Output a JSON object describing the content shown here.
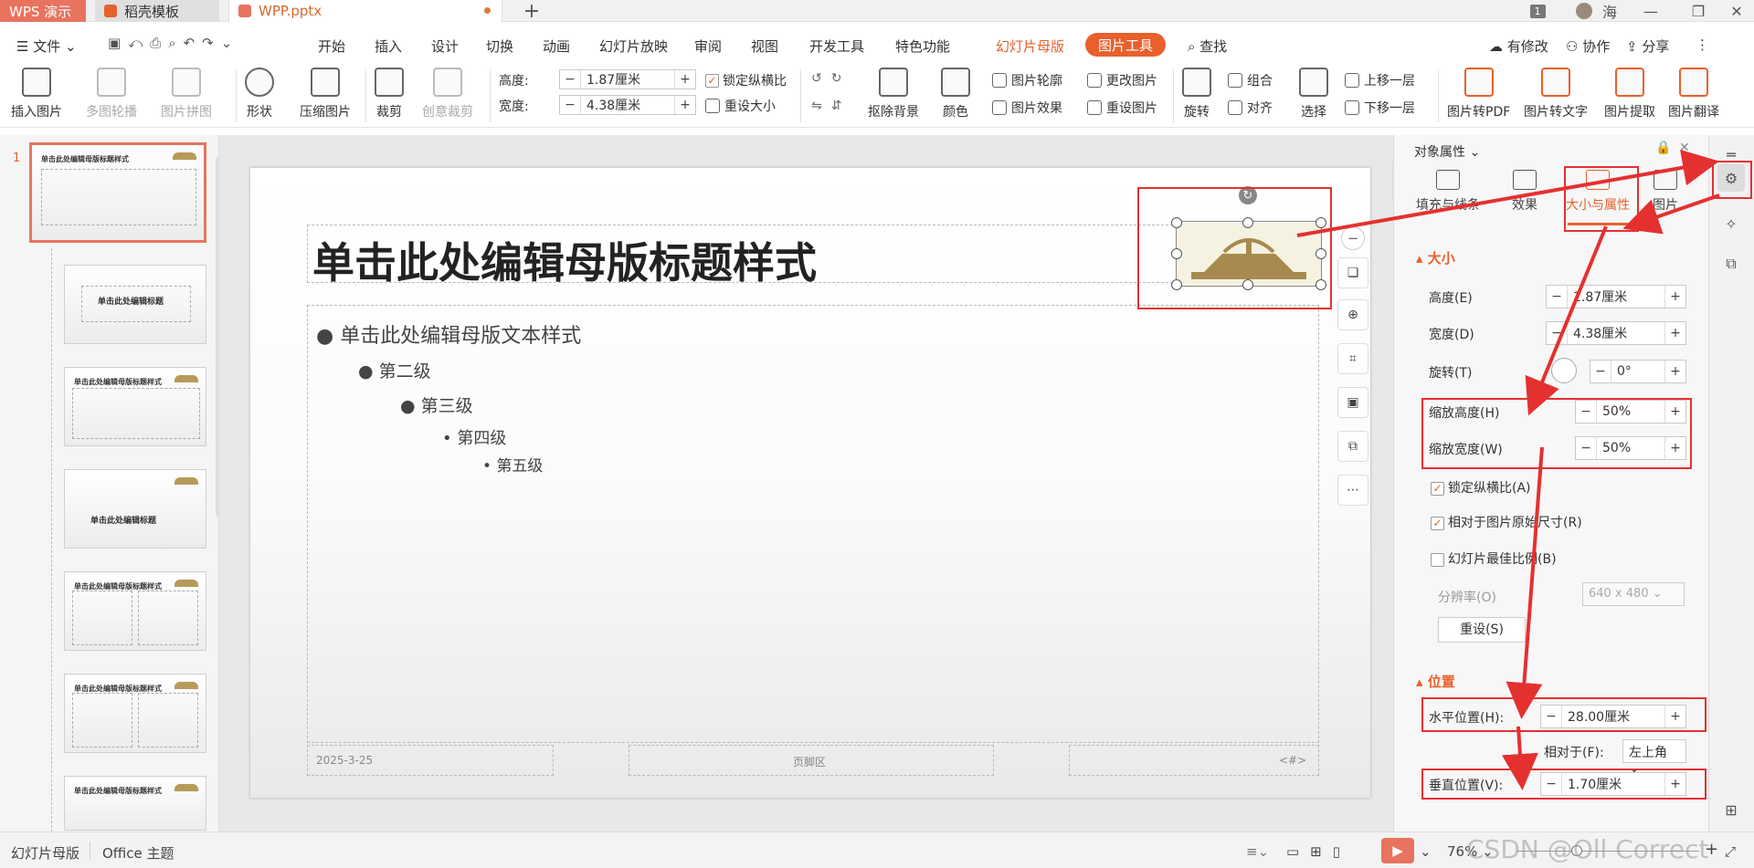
{
  "titlebar": {
    "tabs": [
      "WPS 演示",
      "稻壳模板",
      "WPP.pptx"
    ],
    "user": "海",
    "badge": "1",
    "new_tab": "+"
  },
  "menubar": {
    "file": "文件",
    "items": [
      "开始",
      "插入",
      "设计",
      "切换",
      "动画",
      "幻灯片放映",
      "审阅",
      "视图",
      "开发工具",
      "特色功能"
    ],
    "master": "幻灯片母版",
    "pic_tool": "图片工具",
    "search": "查找",
    "right": [
      "有修改",
      "协作",
      "分享"
    ]
  },
  "ribbon": {
    "insert_pic": "插入图片",
    "multi_carousel": "多图轮播",
    "pic_collage": "图片拼图",
    "shape": "形状",
    "compress": "压缩图片",
    "crop": "裁剪",
    "creative_crop": "创意裁剪",
    "height_label": "高度:",
    "height_value": "1.87厘米",
    "width_label": "宽度:",
    "width_value": "4.38厘米",
    "lock_ratio": "锁定纵横比",
    "reset_size": "重设大小",
    "remove_bg": "抠除背景",
    "color": "颜色",
    "pic_outline": "图片轮廓",
    "pic_effect": "图片效果",
    "change_pic": "更改图片",
    "reset_pic": "重设图片",
    "rotate": "旋转",
    "group": "组合",
    "align": "对齐",
    "select": "选择",
    "bring_forward": "上移一层",
    "send_backward": "下移一层",
    "to_pdf": "图片转PDF",
    "to_text": "图片转文字",
    "extract": "图片提取",
    "translate": "图片翻译"
  },
  "thumbs": {
    "number": "1",
    "title_text": "单击此处编辑母版标题样式",
    "title_short": "单击此处编辑标题"
  },
  "slide": {
    "title": "单击此处编辑母版标题样式",
    "levels": [
      "单击此处编辑母版文本样式",
      "第二级",
      "第三级",
      "第四级",
      "第五级"
    ],
    "date": "2025-3-25",
    "footer": "页脚区",
    "page": "<#>"
  },
  "panel": {
    "header": "对象属性",
    "tabs": [
      "填充与线条",
      "效果",
      "大小与属性",
      "图片"
    ],
    "size_section": "大小",
    "height_label": "高度(E)",
    "height_value": "1.87厘米",
    "width_label": "宽度(D)",
    "width_value": "4.38厘米",
    "rotate_label": "旋转(T)",
    "rotate_value": "0°",
    "scale_h_label": "缩放高度(H)",
    "scale_h_value": "50%",
    "scale_w_label": "缩放宽度(W)",
    "scale_w_value": "50%",
    "lock_ratio": "锁定纵横比(A)",
    "relative_original": "相对于图片原始尺寸(R)",
    "best_scale": "幻灯片最佳比例(B)",
    "resolution_label": "分辨率(O)",
    "resolution_value": "640 x 480",
    "reset_button": "重设(S)",
    "position_section": "位置",
    "hpos_label": "水平位置(H):",
    "hpos_value": "28.00厘米",
    "relative_label": "相对于(F):",
    "relative_value": "左上角",
    "vpos_label": "垂直位置(V):",
    "vpos_value": "1.70厘米"
  },
  "status": {
    "view_label": "幻灯片母版",
    "theme": "Office 主题",
    "zoom": "76%",
    "watermark": "CSDN @Oll Correct"
  },
  "colors": {
    "accent": "#e8602c",
    "annotation_red": "#e53030",
    "logo_gold": "#a88a4e"
  }
}
